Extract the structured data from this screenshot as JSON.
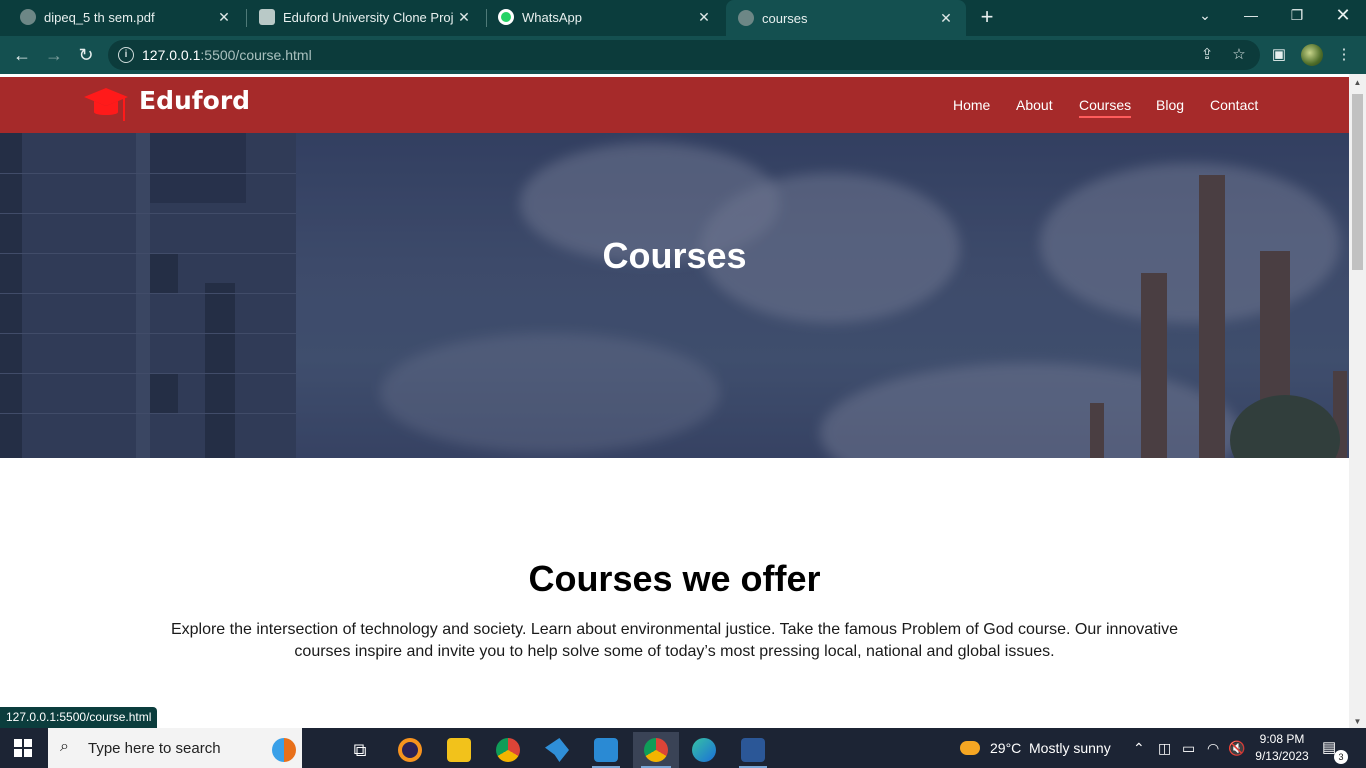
{
  "browser": {
    "tabs": [
      {
        "title": "dipeq_5 th sem.pdf",
        "icon": "globe-icon"
      },
      {
        "title": "Eduford University Clone Project",
        "icon": "chatgpt-icon"
      },
      {
        "title": "WhatsApp",
        "icon": "whatsapp-icon"
      },
      {
        "title": "courses",
        "icon": "globe-icon",
        "active": true
      }
    ],
    "new_tab": "+",
    "url_host": "127.0.0.1",
    "url_rest": ":5500/course.html",
    "status_url": "127.0.0.1:5500/course.html"
  },
  "site": {
    "brand": "Eduford",
    "brand_color": "#a62a2a",
    "nav": [
      {
        "label": "Home"
      },
      {
        "label": "About"
      },
      {
        "label": "Courses",
        "active": true
      },
      {
        "label": "Blog"
      },
      {
        "label": "Contact"
      }
    ],
    "hero_title": "Courses",
    "section_title": "Courses we offer",
    "section_text": "Explore the intersection of technology and society. Learn about environmental justice. Take the famous Problem of God course. Our innovative courses inspire and invite you to help solve some of today’s most pressing local, national and global issues."
  },
  "taskbar": {
    "search_placeholder": "Type here to search",
    "weather_temp": "29°C",
    "weather_text": "Mostly sunny",
    "time": "9:08 PM",
    "date": "9/13/2023",
    "notification_count": "3"
  }
}
